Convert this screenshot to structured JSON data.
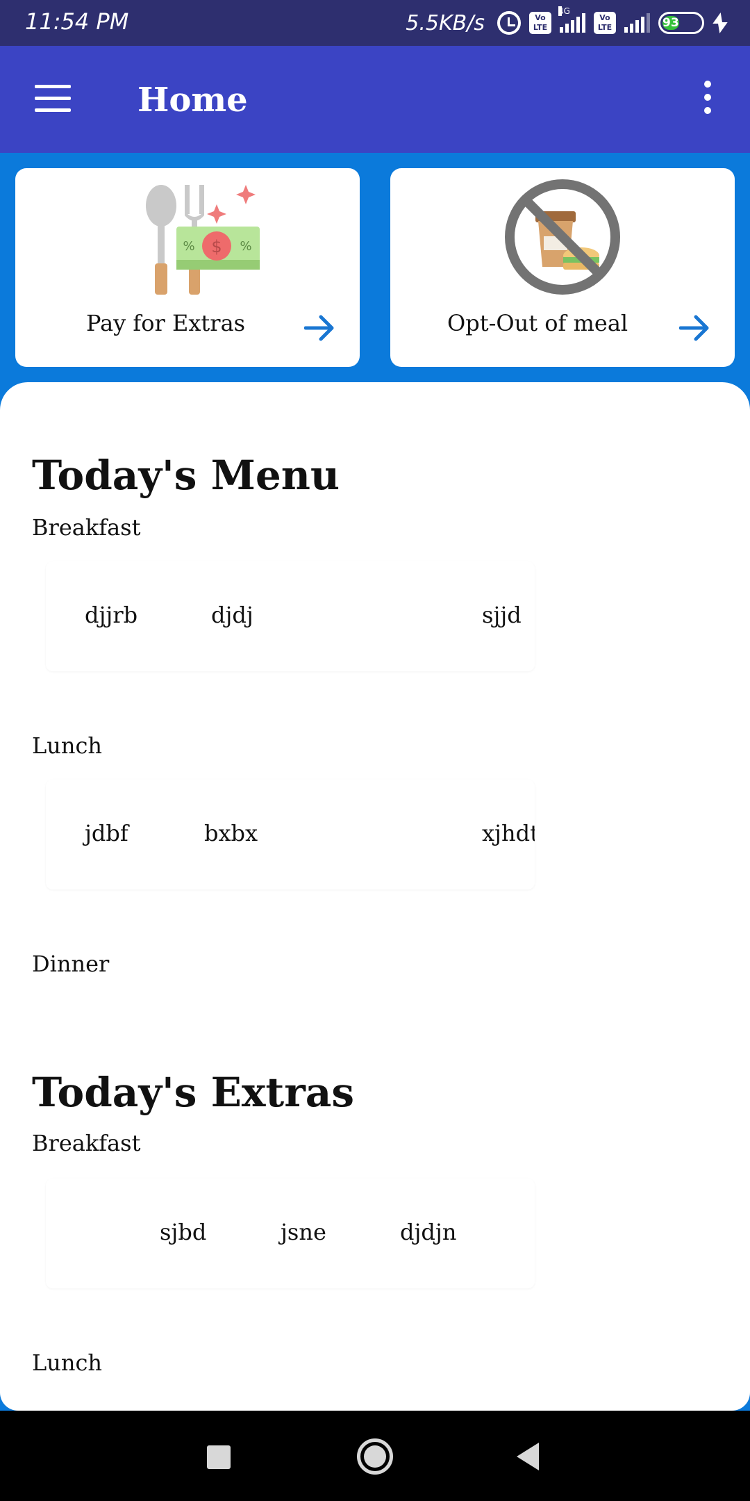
{
  "status_bar": {
    "time": "11:54 PM",
    "net_speed": "5.5KB/s",
    "volte_1": "Vo LTE",
    "volte_2": "Vo LTE",
    "network_type": "4G",
    "battery": "93"
  },
  "app_bar": {
    "title": "Home"
  },
  "action_cards": [
    {
      "label": "Pay for Extras",
      "icon": "cutlery-money-icon"
    },
    {
      "label": "Opt-Out of meal",
      "icon": "no-food-icon"
    }
  ],
  "todays_menu": {
    "title": "Today's Menu",
    "breakfast": {
      "label": "Breakfast",
      "items": [
        "djjrb",
        "djdj",
        "sjjd"
      ]
    },
    "lunch": {
      "label": "Lunch",
      "items": [
        "jdbf",
        "bxbx",
        "xjhdt"
      ]
    },
    "dinner": {
      "label": "Dinner"
    }
  },
  "todays_extras": {
    "title": "Today's Extras",
    "breakfast": {
      "label": "Breakfast",
      "items": [
        "sjbd",
        "jsne",
        "djdjn"
      ]
    },
    "lunch": {
      "label": "Lunch"
    }
  },
  "colors": {
    "status_bar": "#2e2f6f",
    "app_bar": "#3b44c4",
    "background": "#0b7adb",
    "accent_arrow": "#1976d2"
  }
}
